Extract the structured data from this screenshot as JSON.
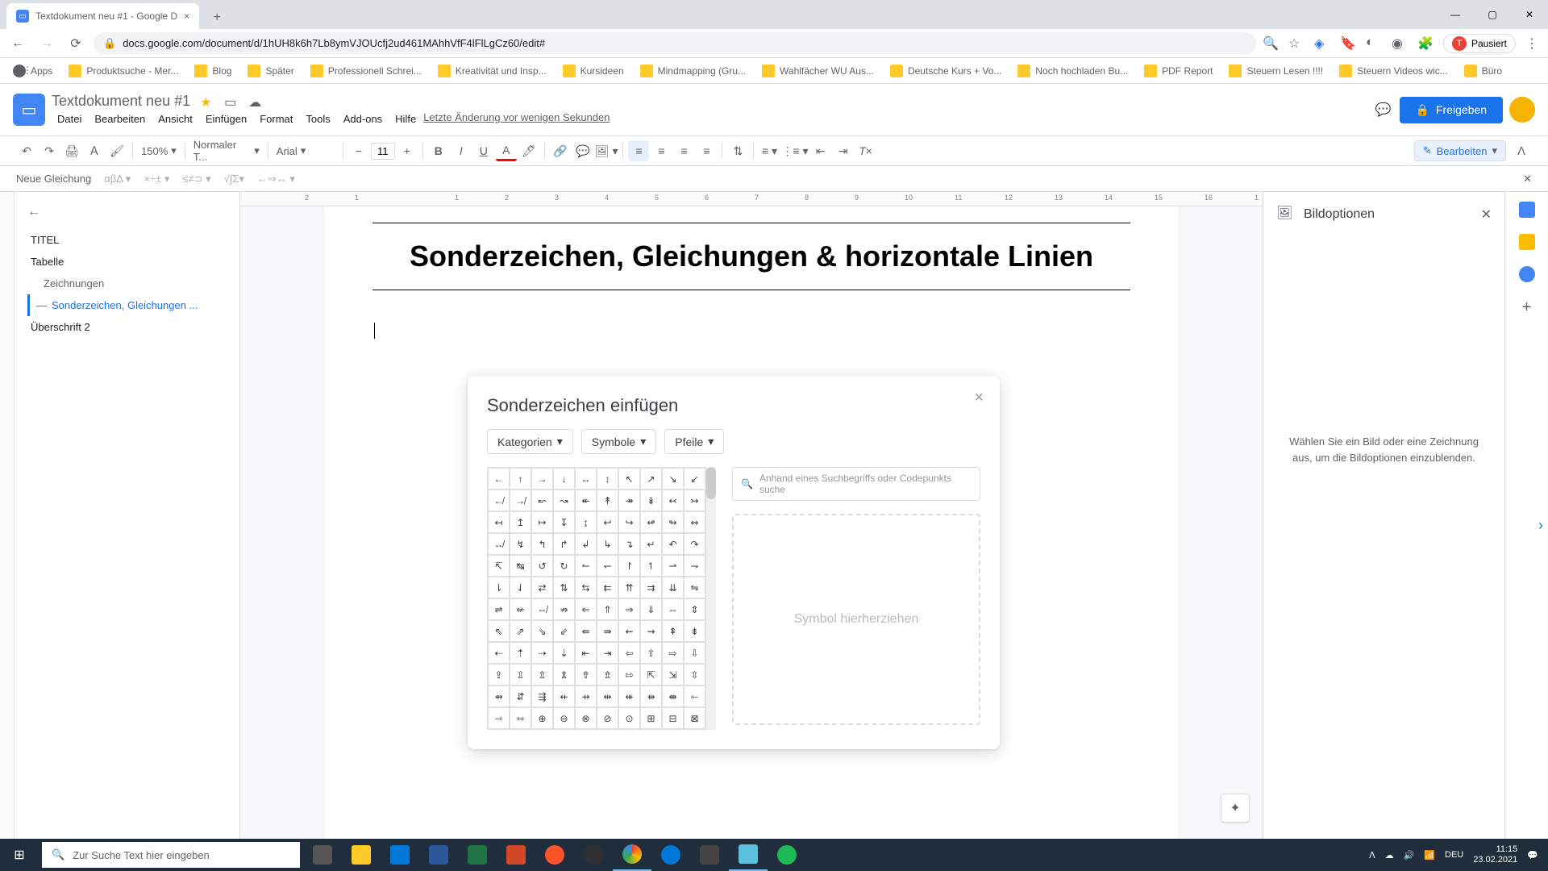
{
  "browser": {
    "tab_title": "Textdokument neu #1 - Google D",
    "url": "docs.google.com/document/d/1hUH8k6h7Lb8ymVJOUcfj2ud461MAhhVfF4lFlLgCz60/edit#",
    "bookmarks": [
      "Apps",
      "Produktsuche - Mer...",
      "Blog",
      "Später",
      "Professionell Schrei...",
      "Kreativität und Insp...",
      "Kursideen",
      "Mindmapping (Gru...",
      "Wahlfächer WU Aus...",
      "Deutsche Kurs + Vo...",
      "Noch hochladen Bu...",
      "PDF Report",
      "Steuern Lesen !!!!",
      "Steuern Videos wic...",
      "Büro"
    ],
    "pausiert": "Pausiert"
  },
  "docs": {
    "title": "Textdokument neu #1",
    "menu": [
      "Datei",
      "Bearbeiten",
      "Ansicht",
      "Einfügen",
      "Format",
      "Tools",
      "Add-ons",
      "Hilfe"
    ],
    "last_change": "Letzte Änderung vor wenigen Sekunden",
    "share": "Freigeben"
  },
  "toolbar": {
    "zoom": "150%",
    "style": "Normaler T...",
    "font": "Arial",
    "font_size": "11",
    "edit_mode": "Bearbeiten"
  },
  "equation_bar": {
    "new_eq": "Neue Gleichung"
  },
  "ruler_numbers": [
    "2",
    "1",
    "",
    "1",
    "2",
    "3",
    "4",
    "5",
    "6",
    "7",
    "8",
    "9",
    "10",
    "11",
    "12",
    "13",
    "14",
    "15",
    "16",
    "1"
  ],
  "outline": {
    "items": [
      {
        "label": "TITEL",
        "level": 1
      },
      {
        "label": "Tabelle",
        "level": 1
      },
      {
        "label": "Zeichnungen",
        "level": 2
      },
      {
        "label": "Sonderzeichen, Gleichungen ...",
        "level": 1,
        "active": true
      },
      {
        "label": "Überschrift 2",
        "level": 1
      }
    ]
  },
  "page": {
    "heading": "Sonderzeichen, Gleichungen & horizontale Linien"
  },
  "side_panel": {
    "title": "Bildoptionen",
    "message": "Wählen Sie ein Bild oder eine Zeichnung aus, um die Bildoptionen einzublenden."
  },
  "modal": {
    "title": "Sonderzeichen einfügen",
    "filters": [
      "Kategorien",
      "Symbole",
      "Pfeile"
    ],
    "search_placeholder": "Anhand eines Suchbegriffs oder Codepunkts suche",
    "draw_placeholder": "Symbol hierherziehen",
    "chars": [
      "←",
      "↑",
      "→",
      "↓",
      "↔",
      "↕",
      "↖",
      "↗",
      "↘",
      "↙",
      "↚",
      "↛",
      "↜",
      "↝",
      "↞",
      "↟",
      "↠",
      "↡",
      "↢",
      "↣",
      "↤",
      "↥",
      "↦",
      "↧",
      "↨",
      "↩",
      "↪",
      "↫",
      "↬",
      "↭",
      "↮",
      "↯",
      "↰",
      "↱",
      "↲",
      "↳",
      "↴",
      "↵",
      "↶",
      "↷",
      "↸",
      "↹",
      "↺",
      "↻",
      "↼",
      "↽",
      "↾",
      "↿",
      "⇀",
      "⇁",
      "⇂",
      "⇃",
      "⇄",
      "⇅",
      "⇆",
      "⇇",
      "⇈",
      "⇉",
      "⇊",
      "⇋",
      "⇌",
      "⇍",
      "⇎",
      "⇏",
      "⇐",
      "⇑",
      "⇒",
      "⇓",
      "⇔",
      "⇕",
      "⇖",
      "⇗",
      "⇘",
      "⇙",
      "⇚",
      "⇛",
      "⇜",
      "⇝",
      "⇞",
      "⇟",
      "⇠",
      "⇡",
      "⇢",
      "⇣",
      "⇤",
      "⇥",
      "⇦",
      "⇧",
      "⇨",
      "⇩",
      "⇪",
      "⇫",
      "⇬",
      "⇭",
      "⇮",
      "⇯",
      "⇰",
      "⇱",
      "⇲",
      "⇳",
      "⇴",
      "⇵",
      "⇶",
      "⇷",
      "⇸",
      "⇹",
      "⇺",
      "⇻",
      "⇼",
      "⇽",
      "⇾",
      "⇿",
      "⊕",
      "⊖",
      "⊗",
      "⊘",
      "⊙",
      "⊞",
      "⊟",
      "⊠"
    ]
  },
  "taskbar": {
    "search_placeholder": "Zur Suche Text hier eingeben",
    "time": "11:15",
    "date": "23.02.2021",
    "lang": "DEU"
  }
}
